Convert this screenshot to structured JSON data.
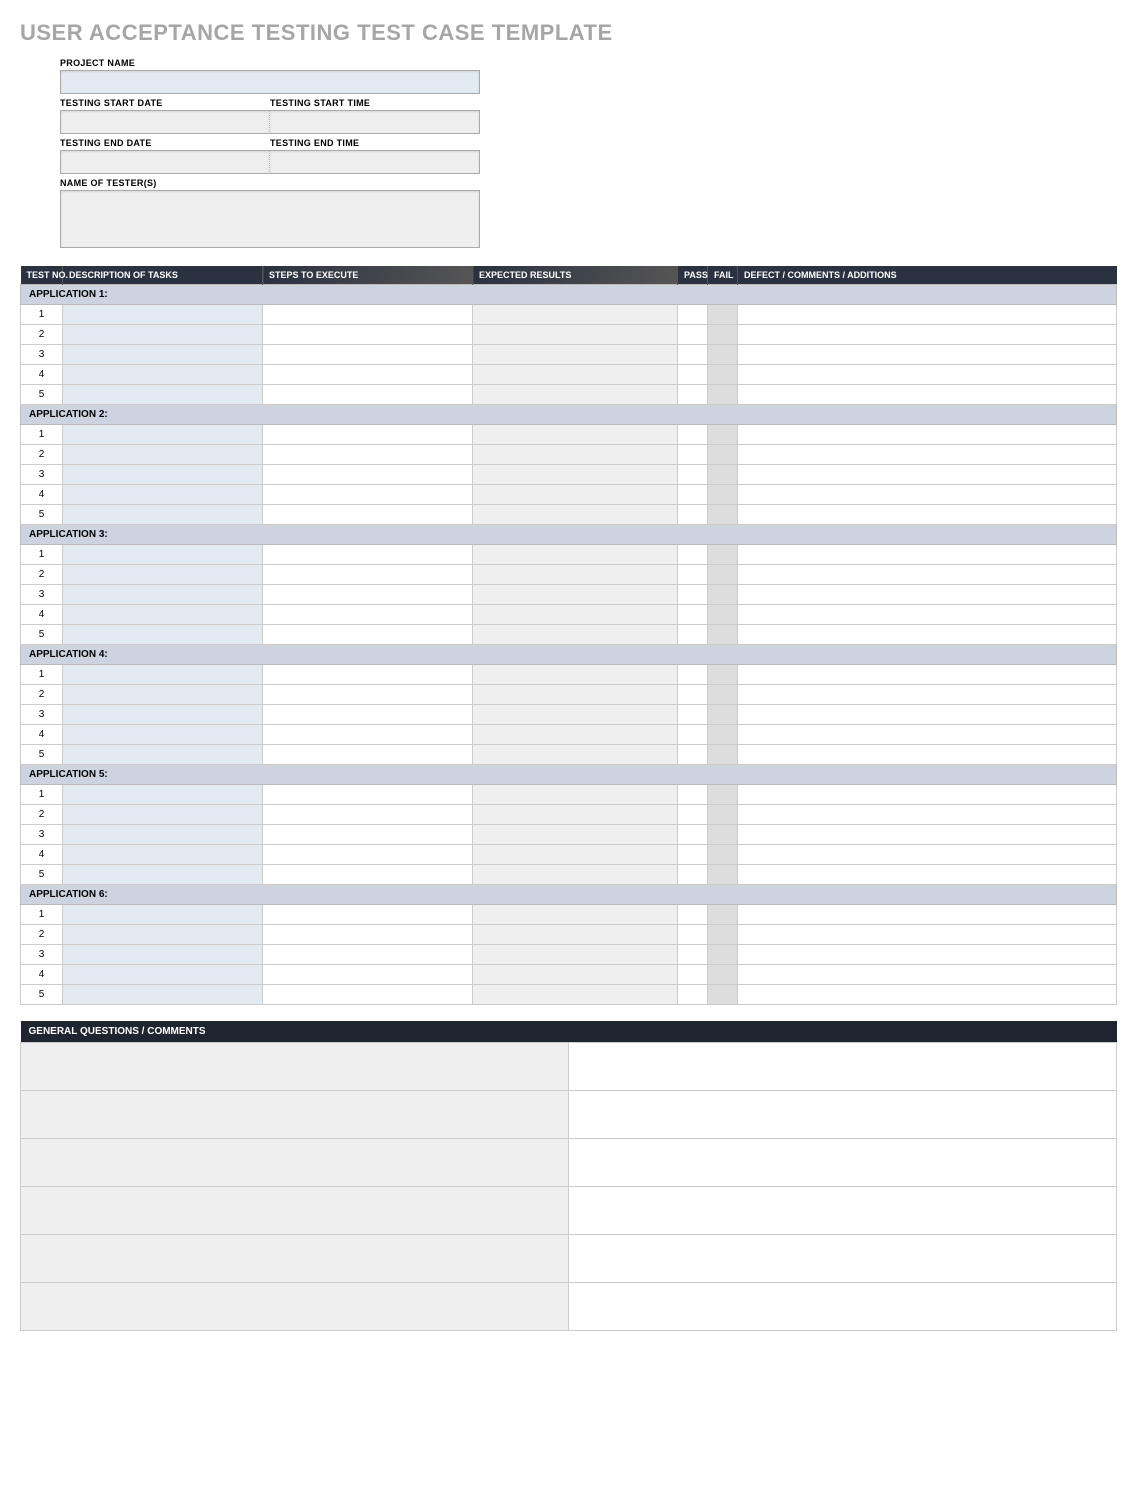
{
  "title": "USER ACCEPTANCE TESTING TEST CASE TEMPLATE",
  "meta": {
    "project_name_label": "PROJECT NAME",
    "start_date_label": "TESTING START DATE",
    "start_time_label": "TESTING START TIME",
    "end_date_label": "TESTING END DATE",
    "end_time_label": "TESTING END TIME",
    "testers_label": "NAME OF TESTER(S)",
    "project_name": "",
    "start_date": "",
    "start_time": "",
    "end_date": "",
    "end_time": "",
    "testers": ""
  },
  "columns": {
    "test_no": "TEST NO.",
    "description": "DESCRIPTION OF TASKS",
    "steps": "STEPS TO EXECUTE",
    "expected": "EXPECTED RESULTS",
    "pass": "PASS",
    "fail": "FAIL",
    "defect": "DEFECT / COMMENTS / ADDITIONS"
  },
  "applications": [
    {
      "label": "APPLICATION 1:",
      "rows": [
        {
          "no": "1",
          "desc": "",
          "steps": "",
          "exp": "",
          "pass": "",
          "fail": "",
          "def": ""
        },
        {
          "no": "2",
          "desc": "",
          "steps": "",
          "exp": "",
          "pass": "",
          "fail": "",
          "def": ""
        },
        {
          "no": "3",
          "desc": "",
          "steps": "",
          "exp": "",
          "pass": "",
          "fail": "",
          "def": ""
        },
        {
          "no": "4",
          "desc": "",
          "steps": "",
          "exp": "",
          "pass": "",
          "fail": "",
          "def": ""
        },
        {
          "no": "5",
          "desc": "",
          "steps": "",
          "exp": "",
          "pass": "",
          "fail": "",
          "def": ""
        }
      ]
    },
    {
      "label": "APPLICATION 2:",
      "rows": [
        {
          "no": "1",
          "desc": "",
          "steps": "",
          "exp": "",
          "pass": "",
          "fail": "",
          "def": ""
        },
        {
          "no": "2",
          "desc": "",
          "steps": "",
          "exp": "",
          "pass": "",
          "fail": "",
          "def": ""
        },
        {
          "no": "3",
          "desc": "",
          "steps": "",
          "exp": "",
          "pass": "",
          "fail": "",
          "def": ""
        },
        {
          "no": "4",
          "desc": "",
          "steps": "",
          "exp": "",
          "pass": "",
          "fail": "",
          "def": ""
        },
        {
          "no": "5",
          "desc": "",
          "steps": "",
          "exp": "",
          "pass": "",
          "fail": "",
          "def": ""
        }
      ]
    },
    {
      "label": "APPLICATION 3:",
      "rows": [
        {
          "no": "1",
          "desc": "",
          "steps": "",
          "exp": "",
          "pass": "",
          "fail": "",
          "def": ""
        },
        {
          "no": "2",
          "desc": "",
          "steps": "",
          "exp": "",
          "pass": "",
          "fail": "",
          "def": ""
        },
        {
          "no": "3",
          "desc": "",
          "steps": "",
          "exp": "",
          "pass": "",
          "fail": "",
          "def": ""
        },
        {
          "no": "4",
          "desc": "",
          "steps": "",
          "exp": "",
          "pass": "",
          "fail": "",
          "def": ""
        },
        {
          "no": "5",
          "desc": "",
          "steps": "",
          "exp": "",
          "pass": "",
          "fail": "",
          "def": ""
        }
      ]
    },
    {
      "label": "APPLICATION 4:",
      "rows": [
        {
          "no": "1",
          "desc": "",
          "steps": "",
          "exp": "",
          "pass": "",
          "fail": "",
          "def": ""
        },
        {
          "no": "2",
          "desc": "",
          "steps": "",
          "exp": "",
          "pass": "",
          "fail": "",
          "def": ""
        },
        {
          "no": "3",
          "desc": "",
          "steps": "",
          "exp": "",
          "pass": "",
          "fail": "",
          "def": ""
        },
        {
          "no": "4",
          "desc": "",
          "steps": "",
          "exp": "",
          "pass": "",
          "fail": "",
          "def": ""
        },
        {
          "no": "5",
          "desc": "",
          "steps": "",
          "exp": "",
          "pass": "",
          "fail": "",
          "def": ""
        }
      ]
    },
    {
      "label": "APPLICATION 5:",
      "rows": [
        {
          "no": "1",
          "desc": "",
          "steps": "",
          "exp": "",
          "pass": "",
          "fail": "",
          "def": ""
        },
        {
          "no": "2",
          "desc": "",
          "steps": "",
          "exp": "",
          "pass": "",
          "fail": "",
          "def": ""
        },
        {
          "no": "3",
          "desc": "",
          "steps": "",
          "exp": "",
          "pass": "",
          "fail": "",
          "def": ""
        },
        {
          "no": "4",
          "desc": "",
          "steps": "",
          "exp": "",
          "pass": "",
          "fail": "",
          "def": ""
        },
        {
          "no": "5",
          "desc": "",
          "steps": "",
          "exp": "",
          "pass": "",
          "fail": "",
          "def": ""
        }
      ]
    },
    {
      "label": "APPLICATION 6:",
      "rows": [
        {
          "no": "1",
          "desc": "",
          "steps": "",
          "exp": "",
          "pass": "",
          "fail": "",
          "def": ""
        },
        {
          "no": "2",
          "desc": "",
          "steps": "",
          "exp": "",
          "pass": "",
          "fail": "",
          "def": ""
        },
        {
          "no": "3",
          "desc": "",
          "steps": "",
          "exp": "",
          "pass": "",
          "fail": "",
          "def": ""
        },
        {
          "no": "4",
          "desc": "",
          "steps": "",
          "exp": "",
          "pass": "",
          "fail": "",
          "def": ""
        },
        {
          "no": "5",
          "desc": "",
          "steps": "",
          "exp": "",
          "pass": "",
          "fail": "",
          "def": ""
        }
      ]
    }
  ],
  "general_questions": {
    "header": "GENERAL QUESTIONS / COMMENTS",
    "rows": [
      {
        "label": "",
        "value": ""
      },
      {
        "label": "",
        "value": ""
      },
      {
        "label": "",
        "value": ""
      },
      {
        "label": "",
        "value": ""
      },
      {
        "label": "",
        "value": ""
      },
      {
        "label": "",
        "value": ""
      }
    ]
  }
}
